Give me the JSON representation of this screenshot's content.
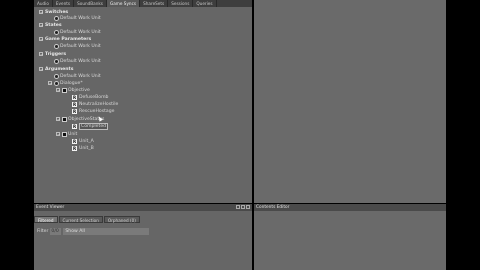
{
  "tabs": [
    "Audio",
    "Events",
    "SoundBanks",
    "Game Syncs",
    "ShareSets",
    "Sessions",
    "Queries"
  ],
  "active_tab_index": 3,
  "tree": [
    {
      "type": "category",
      "label": "Switches"
    },
    {
      "type": "work_unit",
      "label": "Default Work Unit"
    },
    {
      "type": "category",
      "label": "States"
    },
    {
      "type": "work_unit",
      "label": "Default Work Unit"
    },
    {
      "type": "category",
      "label": "Game Parameters"
    },
    {
      "type": "work_unit",
      "label": "Default Work Unit"
    },
    {
      "type": "category",
      "label": "Triggers"
    },
    {
      "type": "work_unit",
      "label": "Default Work Unit"
    },
    {
      "type": "category",
      "label": "Arguments"
    },
    {
      "type": "work_unit",
      "label": "Default Work Unit"
    },
    {
      "type": "folder",
      "label": "Dialogue*"
    },
    {
      "type": "argument",
      "label": "Objective"
    },
    {
      "type": "value",
      "label": "DefuseBomb"
    },
    {
      "type": "value",
      "label": "NeutralizeHostile"
    },
    {
      "type": "value",
      "label": "RescueHostage"
    },
    {
      "type": "argument",
      "label": "ObjectiveStatus"
    },
    {
      "type": "value",
      "label": "Completed"
    },
    {
      "type": "argument",
      "label": "Unit"
    },
    {
      "type": "value",
      "label": "Unit_A"
    },
    {
      "type": "value",
      "label": "Unit_B"
    }
  ],
  "event_viewer": {
    "title": "Event Viewer",
    "tabs": [
      "Filtered",
      "Current Selection",
      "Orphaned (0)"
    ],
    "filter_label": "Filter",
    "filter_value": "0/0",
    "show_all": "Show All"
  },
  "contents_editor": {
    "title": "Contents Editor"
  }
}
